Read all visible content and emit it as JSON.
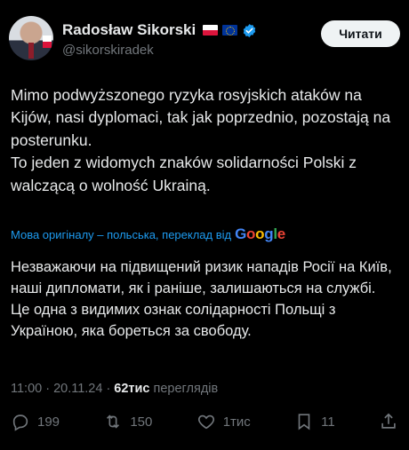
{
  "author": {
    "name": "Radosław Sikorski",
    "handle": "@sikorskiradek",
    "badges": [
      "poland-flag",
      "eu-flag",
      "verified-badge"
    ]
  },
  "follow_button": {
    "label": "Читати"
  },
  "post": {
    "paragraphs": [
      "Mimo podwyższonego ryzyka rosyjskich ataków na Kijów, nasi dyplomaci, tak jak poprzednio, pozostają na posterunku.",
      "To jeden z widomych znaków solidarności Polski z walczącą o wolność Ukrainą."
    ]
  },
  "translation": {
    "note": "Мова оригіналу – польська, переклад від",
    "provider": "Google",
    "paragraphs": [
      "Незважаючи на підвищений ризик нападів Росії на Київ, наші дипломати, як і раніше, залишаються на службі.",
      "Це одна з видимих ознак солідарності Польщі з Україною, яка бореться за свободу."
    ]
  },
  "meta": {
    "time": "11:00",
    "date": "20.11.24",
    "separator": "·",
    "views_count": "62тис",
    "views_label": "переглядів"
  },
  "actions": {
    "replies": "199",
    "reposts": "150",
    "likes": "1тис",
    "bookmarks": "11"
  },
  "colors": {
    "background": "#000000",
    "text": "#e7e9ea",
    "secondary": "#71767b",
    "link": "#1d9bf0",
    "verified": "#1d9bf0"
  }
}
